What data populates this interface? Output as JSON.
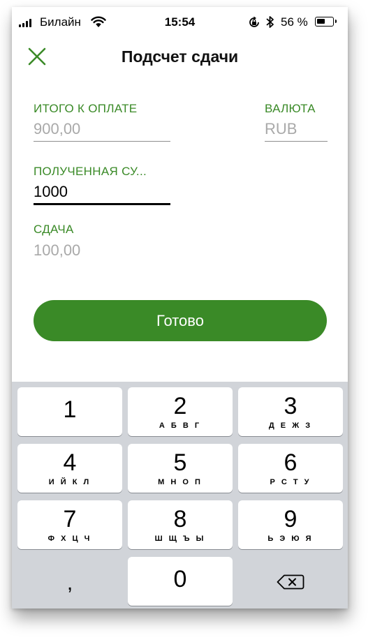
{
  "status_bar": {
    "carrier": "Билайн",
    "time": "15:54",
    "battery_percent": "56 %",
    "battery_level": 0.56,
    "icons": [
      "signal-icon",
      "wifi-icon",
      "orientation-lock-icon",
      "bluetooth-icon",
      "battery-icon"
    ]
  },
  "header": {
    "title": "Подсчет сдачи",
    "close_icon": "close-icon"
  },
  "form": {
    "total": {
      "label": "ИТОГО К ОПЛАТЕ",
      "value": "900,00"
    },
    "currency": {
      "label": "ВАЛЮТА",
      "value": "RUB"
    },
    "received": {
      "label": "ПОЛУЧЕННАЯ СУ...",
      "value": "1000"
    },
    "change": {
      "label": "СДАЧА",
      "value": "100,00"
    }
  },
  "done_button": {
    "label": "Готово"
  },
  "keyboard": {
    "keys": [
      {
        "num": "1",
        "letters": ""
      },
      {
        "num": "2",
        "letters": "А Б В Г"
      },
      {
        "num": "3",
        "letters": "Д Е Ж З"
      },
      {
        "num": "4",
        "letters": "И Й К Л"
      },
      {
        "num": "5",
        "letters": "М Н О П"
      },
      {
        "num": "6",
        "letters": "Р С Т У"
      },
      {
        "num": "7",
        "letters": "Ф Х Ц Ч"
      },
      {
        "num": "8",
        "letters": "Ш Щ Ъ Ы"
      },
      {
        "num": "9",
        "letters": "Ь Э Ю Я"
      }
    ],
    "comma": ",",
    "zero": "0",
    "delete_icon": "backspace-icon"
  },
  "colors": {
    "accent": "#3a8a27",
    "placeholder": "#a9a9a9",
    "keyboard_bg": "#d1d4d9"
  }
}
